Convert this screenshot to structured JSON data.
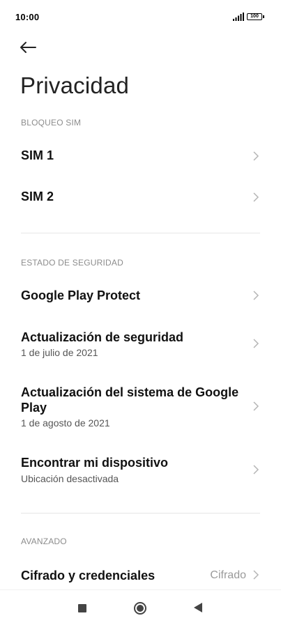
{
  "status_bar": {
    "time": "10:00",
    "battery": "100"
  },
  "header": {
    "back_icon": "arrow-left-icon",
    "title": "Privacidad"
  },
  "sections": {
    "sim_lock": {
      "header": "BLOQUEO SIM",
      "items": [
        {
          "title": "SIM 1"
        },
        {
          "title": "SIM 2"
        }
      ]
    },
    "security_status": {
      "header": "ESTADO DE SEGURIDAD",
      "items": [
        {
          "title": "Google Play Protect"
        },
        {
          "title": "Actualización de seguridad",
          "subtitle": "1 de julio de 2021"
        },
        {
          "title": "Actualización del sistema de Google Play",
          "subtitle": "1 de agosto de 2021"
        },
        {
          "title": "Encontrar mi dispositivo",
          "subtitle": "Ubicación desactivada"
        }
      ]
    },
    "advanced": {
      "header": "AVANZADO",
      "items": [
        {
          "title": "Cifrado y credenciales",
          "value": "Cifrado"
        }
      ]
    }
  },
  "nav_bar": {
    "recent_icon": "square-icon",
    "home_icon": "circle-icon",
    "back_icon": "triangle-back-icon"
  },
  "colors": {
    "section_header": "#8c8c8c",
    "chevron": "#b5b5b5",
    "divider": "#e6e6e6"
  }
}
